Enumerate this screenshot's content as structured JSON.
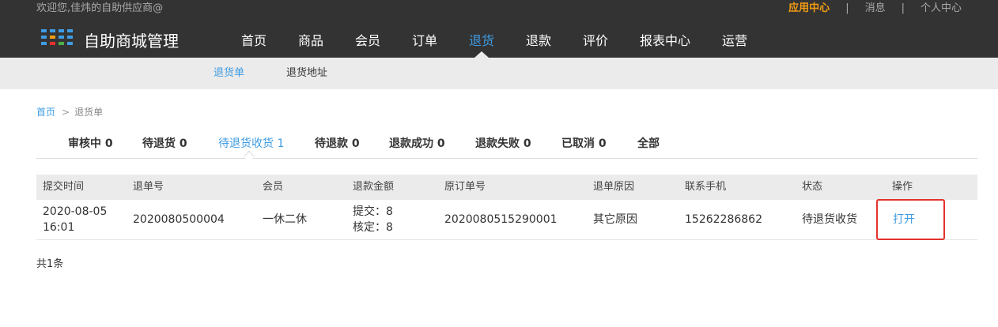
{
  "header": {
    "welcome": "欢迎您,佳炜的自助供应商@",
    "links": [
      {
        "label": "应用中心",
        "active": true
      },
      {
        "label": "消息",
        "active": false
      },
      {
        "label": "个人中心",
        "active": false
      }
    ],
    "separator": "|",
    "brand": "自助商城管理",
    "logo_colors": [
      "#3e9ce3",
      "#f39c12",
      "#e5322d",
      "#4cae4c"
    ],
    "nav": [
      {
        "label": "首页"
      },
      {
        "label": "商品"
      },
      {
        "label": "会员"
      },
      {
        "label": "订单"
      },
      {
        "label": "退货",
        "active": true
      },
      {
        "label": "退款"
      },
      {
        "label": "评价"
      },
      {
        "label": "报表中心"
      },
      {
        "label": "运营"
      }
    ]
  },
  "subnav": [
    {
      "label": "退货单",
      "active": true
    },
    {
      "label": "退货地址"
    }
  ],
  "breadcrumb": {
    "home": "首页",
    "arrow": ">",
    "current": "退货单"
  },
  "tabs": [
    {
      "label": "审核中 0"
    },
    {
      "label": "待退货 0"
    },
    {
      "label": "待退货收货 1",
      "active": true
    },
    {
      "label": "待退款 0"
    },
    {
      "label": "退款成功 0"
    },
    {
      "label": "退款失败 0"
    },
    {
      "label": "已取消 0"
    },
    {
      "label": "全部"
    }
  ],
  "table": {
    "columns": [
      "提交时间",
      "退单号",
      "会员",
      "退款金额",
      "原订单号",
      "退单原因",
      "联系手机",
      "状态",
      "操作"
    ],
    "rows": [
      {
        "time_date": "2020-08-05",
        "time_clock": "16:01",
        "return_no": "2020080500004",
        "member": "一休二休",
        "amount_submit": "提交：8",
        "amount_confirm": "核定：8",
        "order_no": "2020080515290001",
        "reason": "其它原因",
        "phone": "15262286862",
        "status": "待退货收货",
        "action": "打开"
      }
    ]
  },
  "footer": {
    "total": "共1条"
  },
  "colors": {
    "accent": "#3e9ce3",
    "highlight": "#e5322d",
    "topbar": "#333333"
  }
}
